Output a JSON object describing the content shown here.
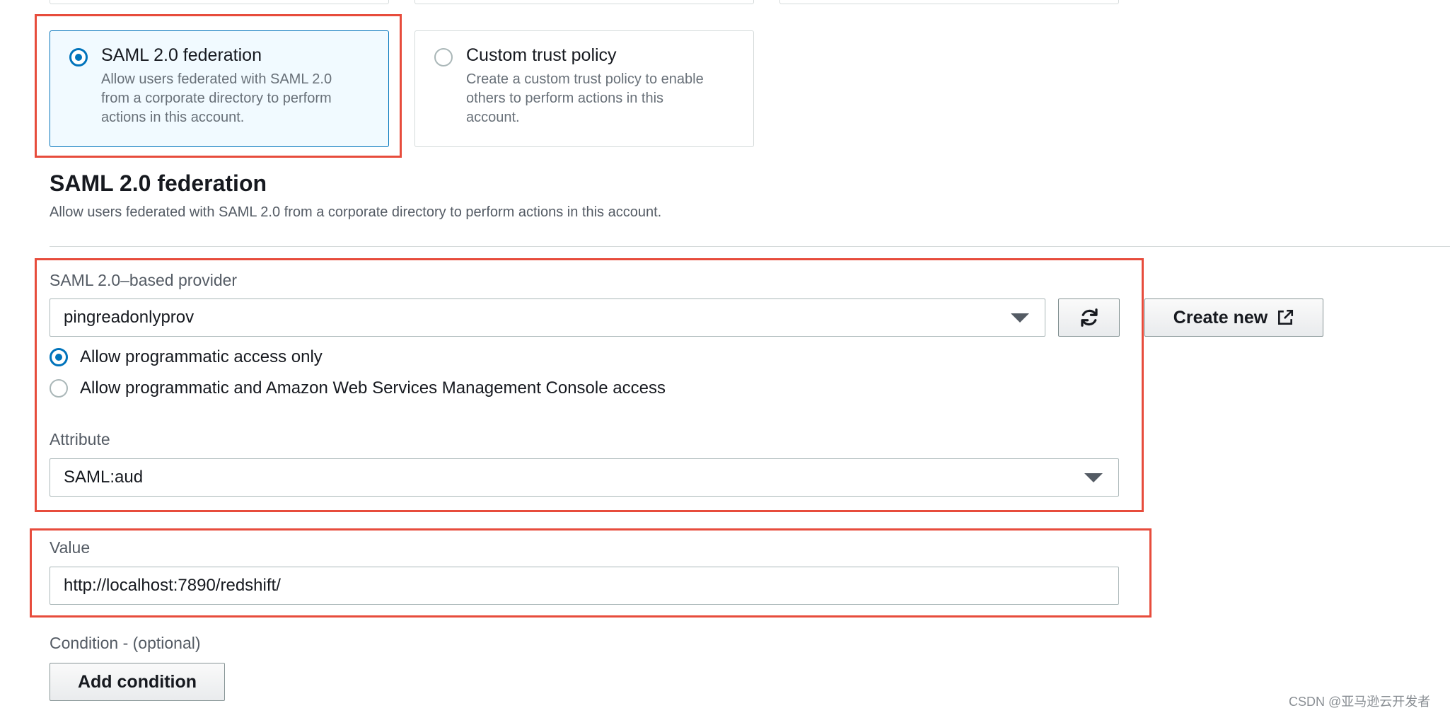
{
  "trust_types": {
    "saml": {
      "title": "SAML 2.0 federation",
      "description_lines": [
        "Allow users federated with SAML 2.0",
        "from a corporate directory to perform",
        "actions in this account."
      ],
      "selected": true
    },
    "custom": {
      "title": "Custom trust policy",
      "description_lines": [
        "Create a custom trust policy to enable",
        "others to perform actions in this",
        "account."
      ],
      "selected": false
    }
  },
  "section": {
    "title": "SAML 2.0 federation",
    "description": "Allow users federated with SAML 2.0 from a corporate directory to perform actions in this account."
  },
  "provider": {
    "label": "SAML 2.0–based provider",
    "selected_value": "pingreadonlyprov",
    "refresh_icon": "refresh-icon",
    "create_new_label": "Create new",
    "create_new_icon": "external-link-icon"
  },
  "access_options": [
    {
      "label": "Allow programmatic access only",
      "checked": true
    },
    {
      "label": "Allow programmatic and Amazon Web Services Management Console access",
      "checked": false
    }
  ],
  "attribute": {
    "label": "Attribute",
    "selected_value": "SAML:aud"
  },
  "value_field": {
    "label": "Value",
    "value": "http://localhost:7890/redshift/"
  },
  "condition": {
    "label": "Condition - (optional)",
    "add_button_label": "Add condition"
  },
  "watermark": "CSDN @亚马逊云开发者",
  "colors": {
    "accent": "#0073bb",
    "highlight_box": "#e74c3c",
    "selected_card_bg": "#f1faff"
  }
}
